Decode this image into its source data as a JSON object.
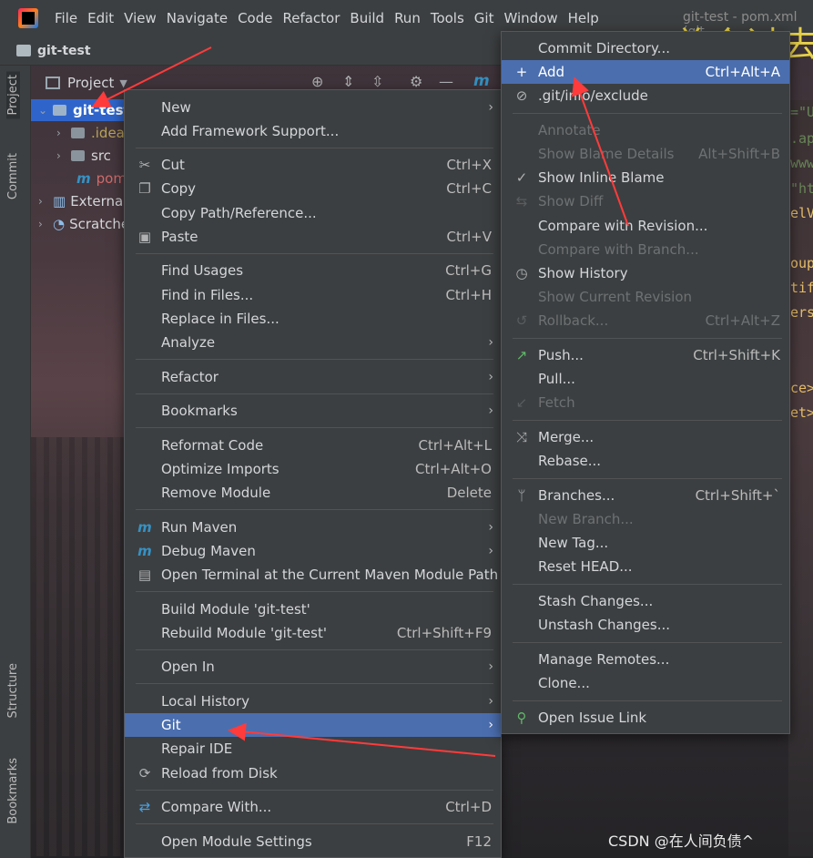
{
  "window": {
    "title": "git-test - pom.xml (git-..."
  },
  "overlay_text": "总会过去",
  "menubar": {
    "items": [
      {
        "label": "File"
      },
      {
        "label": "Edit"
      },
      {
        "label": "View"
      },
      {
        "label": "Navigate"
      },
      {
        "label": "Code"
      },
      {
        "label": "Refactor"
      },
      {
        "label": "Build"
      },
      {
        "label": "Run"
      },
      {
        "label": "Tools"
      },
      {
        "label": "Git"
      },
      {
        "label": "Window"
      },
      {
        "label": "Help"
      }
    ]
  },
  "project_bar": {
    "title": "git-test"
  },
  "left_tabs": {
    "project": "Project",
    "commit": "Commit",
    "structure": "Structure",
    "bookmarks": "Bookmarks"
  },
  "tool_window": {
    "label": "Project",
    "editor_tab": "m"
  },
  "tree": {
    "root": "git-test",
    "items": [
      {
        "label": ".idea"
      },
      {
        "label": "src"
      },
      {
        "label": "pom.xml"
      },
      {
        "label": "External Libraries"
      },
      {
        "label": "Scratches and Consoles"
      }
    ]
  },
  "editor_fragments": [
    "=\"U",
    ".ap",
    "www.",
    "\"ht",
    "elV",
    "oup",
    "tif",
    "ers",
    "ce>",
    "et>"
  ],
  "context_menu": {
    "items": [
      {
        "label": "New",
        "shortcut": "",
        "submenu": true
      },
      {
        "label": "Add Framework Support...",
        "shortcut": ""
      },
      {
        "label": "Cut",
        "shortcut": "Ctrl+X",
        "icon": "scissors-icon"
      },
      {
        "label": "Copy",
        "shortcut": "Ctrl+C",
        "icon": "copy-icon"
      },
      {
        "label": "Copy Path/Reference...",
        "shortcut": ""
      },
      {
        "label": "Paste",
        "shortcut": "Ctrl+V",
        "icon": "clipboard-icon"
      },
      {
        "label": "Find Usages",
        "shortcut": "Ctrl+G"
      },
      {
        "label": "Find in Files...",
        "shortcut": "Ctrl+H"
      },
      {
        "label": "Replace in Files...",
        "shortcut": ""
      },
      {
        "label": "Analyze",
        "shortcut": "",
        "submenu": true
      },
      {
        "label": "Refactor",
        "shortcut": "",
        "submenu": true
      },
      {
        "label": "Bookmarks",
        "shortcut": "",
        "submenu": true
      },
      {
        "label": "Reformat Code",
        "shortcut": "Ctrl+Alt+L"
      },
      {
        "label": "Optimize Imports",
        "shortcut": "Ctrl+Alt+O"
      },
      {
        "label": "Remove Module",
        "shortcut": "Delete"
      },
      {
        "label": "Run Maven",
        "shortcut": "",
        "submenu": true,
        "icon": "maven-icon"
      },
      {
        "label": "Debug Maven",
        "shortcut": "",
        "submenu": true,
        "icon": "maven-debug-icon"
      },
      {
        "label": "Open Terminal at the Current Maven Module Path",
        "shortcut": "",
        "icon": "terminal-icon"
      },
      {
        "label": "Build Module 'git-test'",
        "shortcut": ""
      },
      {
        "label": "Rebuild Module 'git-test'",
        "shortcut": "Ctrl+Shift+F9"
      },
      {
        "label": "Open In",
        "shortcut": "",
        "submenu": true
      },
      {
        "label": "Local History",
        "shortcut": "",
        "submenu": true
      },
      {
        "label": "Git",
        "shortcut": "",
        "submenu": true,
        "selected": true
      },
      {
        "label": "Repair IDE",
        "shortcut": ""
      },
      {
        "label": "Reload from Disk",
        "shortcut": "",
        "icon": "reload-icon"
      },
      {
        "label": "Compare With...",
        "shortcut": "Ctrl+D",
        "icon": "compare-icon"
      },
      {
        "label": "Open Module Settings",
        "shortcut": "F12"
      }
    ]
  },
  "git_menu": {
    "items": [
      {
        "label": "Commit Directory...",
        "shortcut": ""
      },
      {
        "label": "Add",
        "shortcut": "Ctrl+Alt+A",
        "icon": "plus-icon",
        "selected": true
      },
      {
        "label": ".git/info/exclude",
        "shortcut": "",
        "icon": "exclude-file-icon"
      },
      {
        "label": "Annotate",
        "shortcut": "",
        "disabled": true
      },
      {
        "label": "Show Blame Details",
        "shortcut": "Alt+Shift+B",
        "disabled": true
      },
      {
        "label": "Show Inline Blame",
        "shortcut": "",
        "icon": "check-icon"
      },
      {
        "label": "Show Diff",
        "shortcut": "",
        "disabled": true,
        "icon": "diff-icon"
      },
      {
        "label": "Compare with Revision...",
        "shortcut": ""
      },
      {
        "label": "Compare with Branch...",
        "shortcut": "",
        "disabled": true
      },
      {
        "label": "Show History",
        "shortcut": "",
        "icon": "clock-icon"
      },
      {
        "label": "Show Current Revision",
        "shortcut": "",
        "disabled": true
      },
      {
        "label": "Rollback...",
        "shortcut": "Ctrl+Alt+Z",
        "disabled": true,
        "icon": "rollback-icon"
      },
      {
        "label": "Push...",
        "shortcut": "Ctrl+Shift+K",
        "icon": "push-arrow-icon"
      },
      {
        "label": "Pull...",
        "shortcut": ""
      },
      {
        "label": "Fetch",
        "shortcut": "",
        "disabled": true,
        "icon": "fetch-icon"
      },
      {
        "label": "Merge...",
        "shortcut": "",
        "icon": "merge-icon"
      },
      {
        "label": "Rebase...",
        "shortcut": ""
      },
      {
        "label": "Branches...",
        "shortcut": "Ctrl+Shift+`",
        "icon": "branch-icon"
      },
      {
        "label": "New Branch...",
        "shortcut": "",
        "disabled": true
      },
      {
        "label": "New Tag...",
        "shortcut": ""
      },
      {
        "label": "Reset HEAD...",
        "shortcut": ""
      },
      {
        "label": "Stash Changes...",
        "shortcut": ""
      },
      {
        "label": "Unstash Changes...",
        "shortcut": ""
      },
      {
        "label": "Manage Remotes...",
        "shortcut": ""
      },
      {
        "label": "Clone...",
        "shortcut": ""
      },
      {
        "label": "Open Issue Link",
        "shortcut": "",
        "icon": "issue-link-icon"
      }
    ]
  },
  "watermark": "CSDN @在人间负债^",
  "colors": {
    "selection": "#4b6eaf",
    "menu_bg": "#3c3f41",
    "annotation_arrow": "#ff3b3b"
  }
}
